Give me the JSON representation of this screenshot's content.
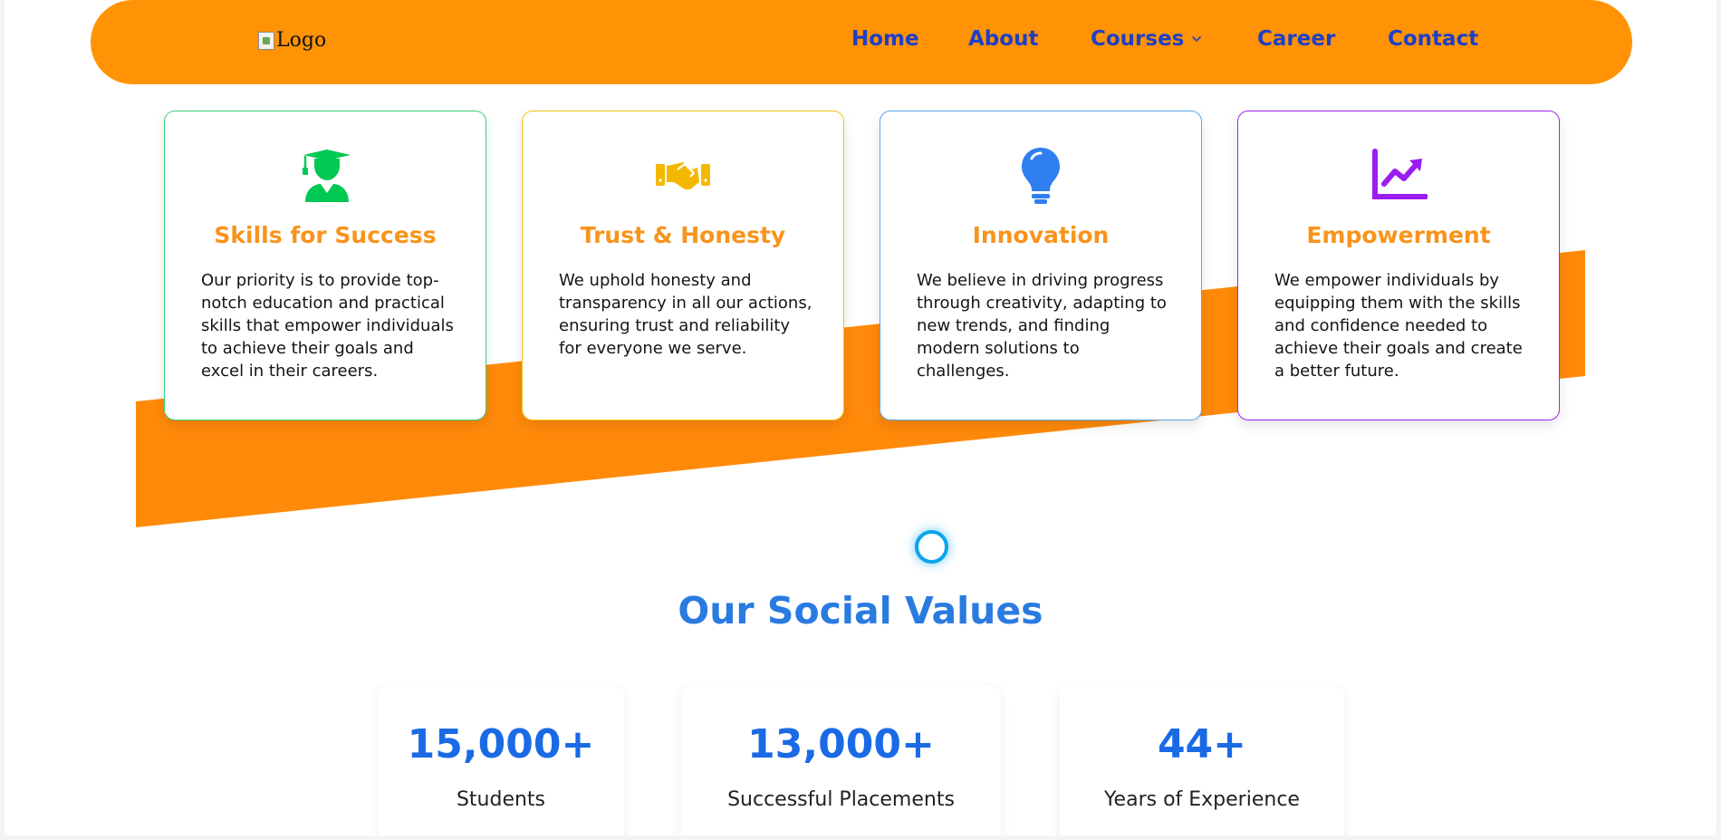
{
  "nav": {
    "logo_alt": "Logo",
    "links": [
      {
        "label": "Home"
      },
      {
        "label": "About"
      },
      {
        "label": "Courses"
      },
      {
        "label": "Career"
      },
      {
        "label": "Contact"
      }
    ]
  },
  "values": [
    {
      "title": "Skills for Success",
      "text": "Our priority is to provide top-notch education and practical skills that empower individuals to achieve their goals and excel in their careers.",
      "icon": "graduate-icon",
      "color": "#00c853"
    },
    {
      "title": "Trust & Honesty",
      "text": "We uphold honesty and transparency in all our actions, ensuring trust and reliability for everyone we serve.",
      "icon": "handshake-icon",
      "color": "#f5b800"
    },
    {
      "title": "Innovation",
      "text": "We believe in driving progress through creativity, adapting to new trends, and finding modern solutions to challenges.",
      "icon": "lightbulb-icon",
      "color": "#2f7ff0"
    },
    {
      "title": "Empowerment",
      "text": "We empower individuals by equipping them with the skills and confidence needed to achieve their goals and create a better future.",
      "icon": "growth-chart-icon",
      "color": "#9b1cf0"
    }
  ],
  "social": {
    "title": "Our Social Values",
    "stats": [
      {
        "value": "15,000+",
        "label": "Students"
      },
      {
        "value": "13,000+",
        "label": "Successful Placements"
      },
      {
        "value": "44+",
        "label": "Years of Experience"
      }
    ]
  },
  "colors": {
    "accent_orange": "#ff9305",
    "nav_link": "#1f3fc6",
    "heading_blue": "#2a7be0"
  }
}
